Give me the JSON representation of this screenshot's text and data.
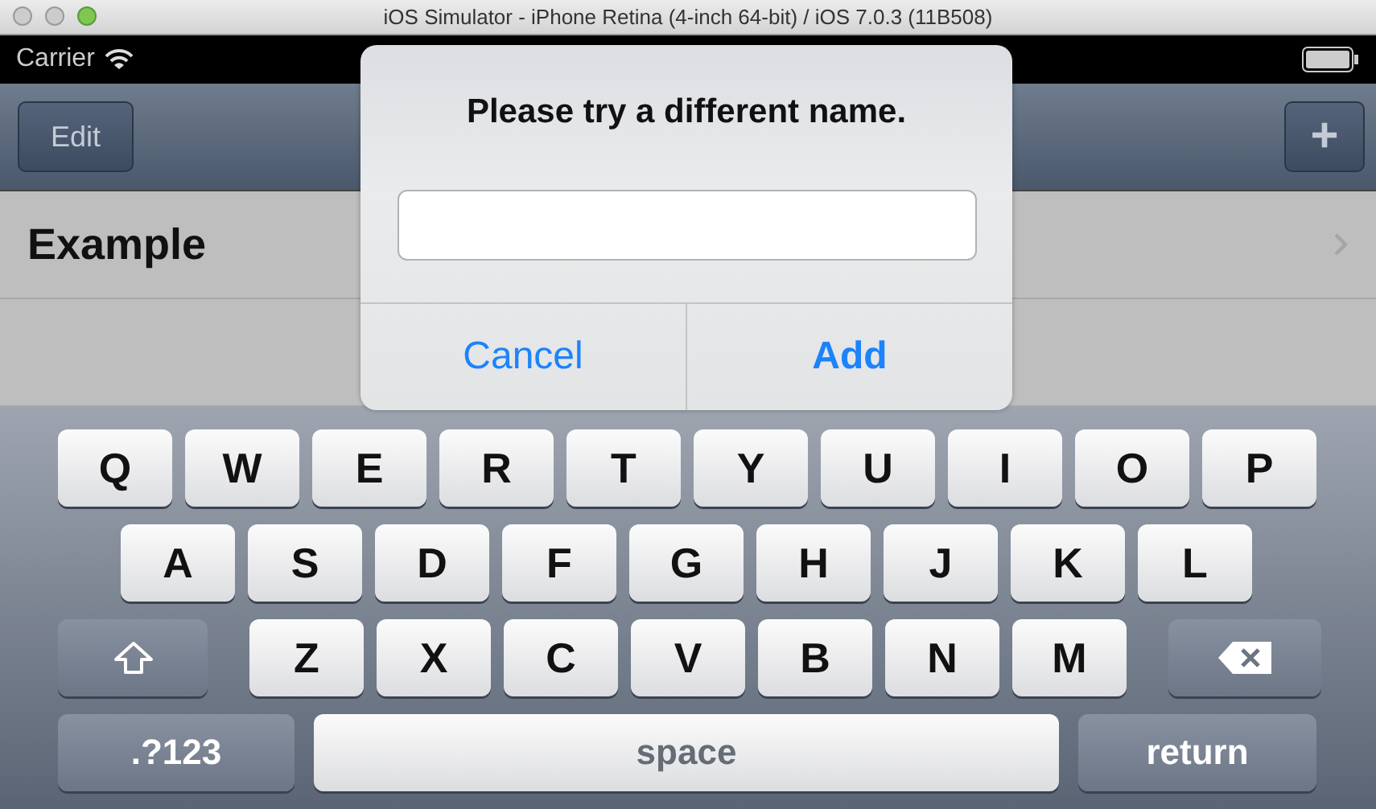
{
  "window": {
    "title": "iOS Simulator - iPhone Retina (4-inch 64-bit) / iOS 7.0.3 (11B508)"
  },
  "status_bar": {
    "carrier": "Carrier"
  },
  "nav_bar": {
    "left_button": "Edit",
    "right_button": "+"
  },
  "list": {
    "rows": [
      {
        "label": "Example",
        "disclosure": true
      },
      {
        "disclosure": false
      }
    ]
  },
  "alert": {
    "title": "Please try a different name.",
    "buttons": [
      {
        "label": "Cancel",
        "kind": "cancel"
      },
      {
        "label": "Add",
        "kind": "default"
      }
    ]
  },
  "keyboard": {
    "rows": [
      {
        "keys": [
          {
            "kind": "letter",
            "label": "Q"
          },
          {
            "kind": "letter",
            "label": "W"
          },
          {
            "kind": "letter",
            "label": "E"
          },
          {
            "kind": "letter",
            "label": "R"
          },
          {
            "kind": "letter",
            "label": "T"
          },
          {
            "kind": "letter",
            "label": "Y"
          },
          {
            "kind": "letter",
            "label": "U"
          },
          {
            "kind": "letter",
            "label": "I"
          },
          {
            "kind": "letter",
            "label": "O"
          },
          {
            "kind": "letter",
            "label": "P"
          }
        ]
      },
      {
        "keys": [
          {
            "kind": "letter",
            "label": "A"
          },
          {
            "kind": "letter",
            "label": "S"
          },
          {
            "kind": "letter",
            "label": "D"
          },
          {
            "kind": "letter",
            "label": "F"
          },
          {
            "kind": "letter",
            "label": "G"
          },
          {
            "kind": "letter",
            "label": "H"
          },
          {
            "kind": "letter",
            "label": "J"
          },
          {
            "kind": "letter",
            "label": "K"
          },
          {
            "kind": "letter",
            "label": "L"
          }
        ]
      },
      {
        "keys": [
          {
            "kind": "shift"
          },
          {
            "kind": "letter",
            "label": "Z"
          },
          {
            "kind": "letter",
            "label": "X"
          },
          {
            "kind": "letter",
            "label": "C"
          },
          {
            "kind": "letter",
            "label": "V"
          },
          {
            "kind": "letter",
            "label": "B"
          },
          {
            "kind": "letter",
            "label": "N"
          },
          {
            "kind": "letter",
            "label": "M"
          },
          {
            "kind": "delete"
          }
        ]
      }
    ],
    "bottom_row": {
      "mode_key": ".?123",
      "space_key": "space",
      "return_key": "return"
    }
  }
}
